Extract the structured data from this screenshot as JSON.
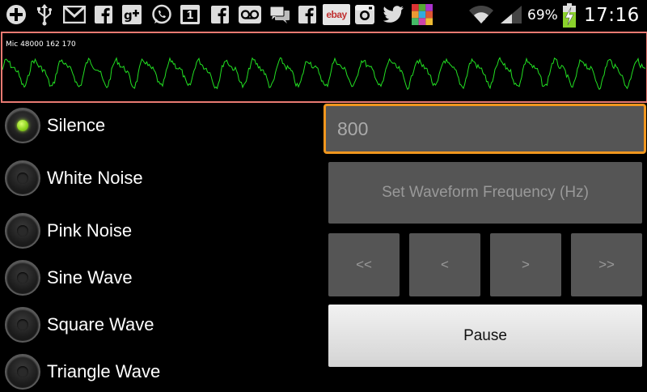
{
  "status_bar": {
    "battery_percent": "69%",
    "time": "17:16",
    "notification_icons": [
      "plus-icon",
      "usb-icon",
      "gmail-icon",
      "facebook-icon",
      "google-plus-icon",
      "whatsapp-icon",
      "calendar-icon",
      "facebook-icon",
      "voicemail-icon",
      "chat-icon",
      "facebook-icon",
      "ebay-icon",
      "instagram-icon",
      "twitter-icon",
      "game-icon"
    ],
    "ebay_text": "ebay",
    "calendar_day": "1",
    "colors": {
      "charging": "#8bd12b"
    }
  },
  "scope": {
    "label": "Mic 48000 162 170",
    "border_color": "#e87a72",
    "trace_color": "#22e022"
  },
  "waveforms": [
    {
      "label": "Silence",
      "selected": true
    },
    {
      "label": "White Noise",
      "selected": false
    },
    {
      "label": "Pink Noise",
      "selected": false
    },
    {
      "label": "Sine Wave",
      "selected": false
    },
    {
      "label": "Square Wave",
      "selected": false
    },
    {
      "label": "Triangle Wave",
      "selected": false
    }
  ],
  "frequency_input": {
    "value": "800",
    "focus_color": "#f0961e"
  },
  "buttons": {
    "set_frequency": "Set Waveform Frequency (Hz)",
    "step_fast_back": "<<",
    "step_back": "<",
    "step_forward": ">",
    "step_fast_forward": ">>",
    "pause": "Pause"
  }
}
